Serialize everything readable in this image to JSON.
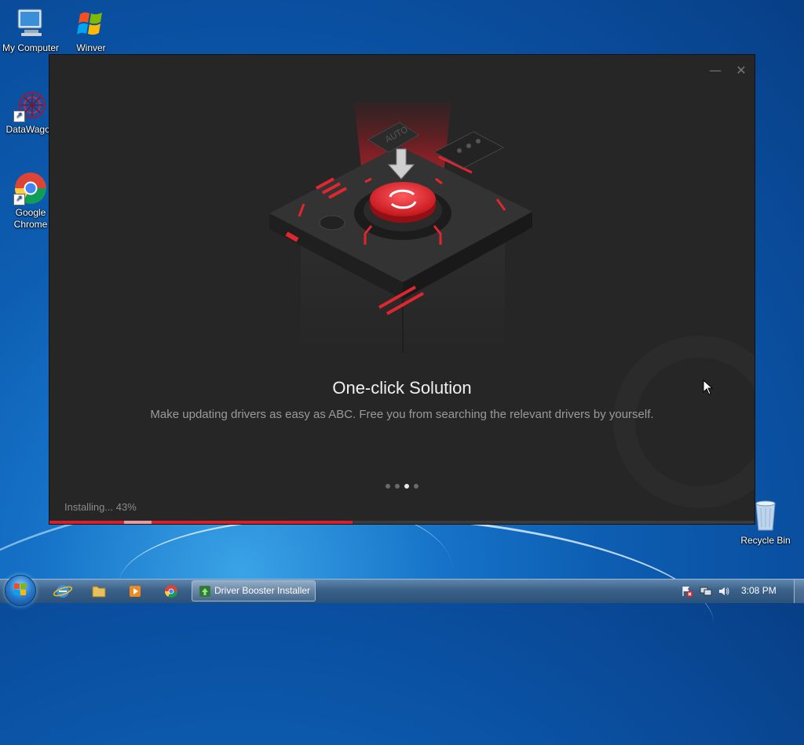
{
  "desktop": {
    "icons": [
      {
        "label": "My Computer",
        "icon": "computer-icon"
      },
      {
        "label": "Winver",
        "icon": "windows-flag-icon"
      },
      {
        "label": "DataWagon",
        "icon": "datawagon-icon"
      },
      {
        "label": "Google Chrome",
        "icon": "chrome-icon"
      },
      {
        "label": "Recycle Bin",
        "icon": "recycle-bin-icon"
      }
    ]
  },
  "installer": {
    "minimize_glyph": "—",
    "close_glyph": "✕",
    "title": "One-click Solution",
    "description": "Make updating drivers as easy as ABC. Free you from searching the relevant drivers by yourself.",
    "slides_total": 4,
    "slide_active": 3,
    "status": "Installing... 43%",
    "progress": 0.43,
    "hero_badge": "AUTO",
    "accent_color": "#d91f27"
  },
  "taskbar": {
    "pinned": [
      "internet-explorer-icon",
      "windows-explorer-icon",
      "media-player-icon",
      "chrome-icon"
    ],
    "active_task": "Driver Booster Installer",
    "tray": [
      "action-center-icon",
      "network-icon",
      "volume-icon"
    ],
    "clock": "3:08 PM"
  }
}
